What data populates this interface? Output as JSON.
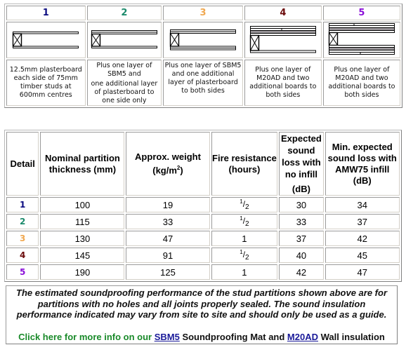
{
  "details": [
    {
      "number": "1",
      "color": "#0b0b80",
      "layers": "basic",
      "description": [
        "12.5mm plasterboard each side of 75mm timber studs at 600mm centres"
      ],
      "align": "middle"
    },
    {
      "number": "2",
      "color": "#1b8a6b",
      "layers": "sbm5-one-side",
      "description": [
        "Plus one layer of SBM5 and",
        "one additional layer of plasterboard to one side only"
      ],
      "align": "top"
    },
    {
      "number": "3",
      "color": "#f0a850",
      "layers": "sbm5-both-sides",
      "description": [
        "Plus one layer of SBM5 and one additional layer of plasterboard to both sides"
      ],
      "align": "top"
    },
    {
      "number": "4",
      "color": "#6b0a0a",
      "layers": "m20ad-one-side",
      "description": [
        "Plus one layer of M20AD and two additional boards to both sides"
      ],
      "align": "middle"
    },
    {
      "number": "5",
      "color": "#8a10d8",
      "layers": "m20ad-both-sides",
      "description": [
        "Plus one layer of M20AD and two additional boards to both sides"
      ],
      "align": "middle"
    }
  ],
  "table": {
    "headers": {
      "detail": "Detail",
      "thickness": "Nominal partition thickness (mm)",
      "weight_prefix": "Approx. weight",
      "weight_unit_prefix": "(kg/m",
      "weight_unit_sup": "2",
      "weight_unit_suffix": ")",
      "fire": "Fire resistance (hours)",
      "expected": "Expected sound loss with no infill",
      "expected_unit": "(dB)",
      "min_expected": "Min. expected sound loss with AMW75 infill (dB)"
    },
    "rows": [
      {
        "detail": "1",
        "thickness": "100",
        "weight": "19",
        "fire": "1/2",
        "expected": "30",
        "min_expected": "34"
      },
      {
        "detail": "2",
        "thickness": "115",
        "weight": "33",
        "fire": "1/2",
        "expected": "33",
        "min_expected": "37"
      },
      {
        "detail": "3",
        "thickness": "130",
        "weight": "47",
        "fire": "1",
        "expected": "37",
        "min_expected": "42"
      },
      {
        "detail": "4",
        "thickness": "145",
        "weight": "91",
        "fire": "1/2",
        "expected": "40",
        "min_expected": "45"
      },
      {
        "detail": "5",
        "thickness": "190",
        "weight": "125",
        "fire": "1",
        "expected": "42",
        "min_expected": "47"
      }
    ]
  },
  "note": {
    "text": "The estimated soundproofing performance of the stud partitions shown above are for partitions with no holes and all joints properly sealed. The sound insulation performance indicated may vary from site to site and should only be used as a guide.",
    "more_prefix": "Click here for more info on our ",
    "link1": "SBM5",
    "middle": " Soundproofing Mat and ",
    "link2": "M20AD",
    "suffix": " Wall insulation"
  },
  "colors": {
    "link": "#1a1a99",
    "promo_green": "#1a8a2a"
  }
}
